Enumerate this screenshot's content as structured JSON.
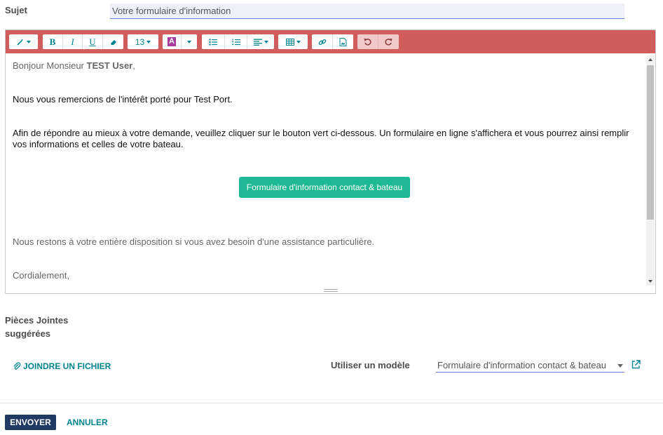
{
  "subject": {
    "label": "Sujet",
    "value": "Votre formulaire d'information"
  },
  "toolbar": {
    "style_icon": "magic-wand-icon",
    "bold": "B",
    "italic": "I",
    "underline": "U",
    "eraser_icon": "eraser-icon",
    "font_size": "13",
    "color_letter": "A",
    "color_accent": "#a53c9f",
    "bg": "#d15c5c",
    "accent": "#00848f"
  },
  "body": {
    "greeting_prefix": "Bonjour Monsieur ",
    "greeting_name": "TEST User",
    "greeting_suffix": ",",
    "line1": "Nous vous remercions de l'intérêt porté pour Test Port.",
    "line2": "Afin de répondre au mieux à votre demande, veuillez cliquer sur le bouton vert ci-dessous. Un formulaire en ligne s'affichera et vous pourrez ainsi remplir vos informations et celles de votre bateau.",
    "cta": "Formulaire d'information contact & bateau",
    "line3": "Nous restons à votre entière disposition si vous avez besoin d'une assistance particulière.",
    "closing": "Cordialement,"
  },
  "attachments": {
    "label_line1": "Pièces Jointes",
    "label_line2": "suggérées",
    "join_label": "JOINDRE UN FICHIER"
  },
  "template": {
    "label": "Utiliser un modèle",
    "value": "Formulaire d'information contact & bateau"
  },
  "footer": {
    "send": "ENVOYER",
    "cancel": "ANNULER"
  },
  "colors": {
    "send_bg": "#1f3a63",
    "cta_bg": "#1fb894",
    "link": "#00848f"
  }
}
